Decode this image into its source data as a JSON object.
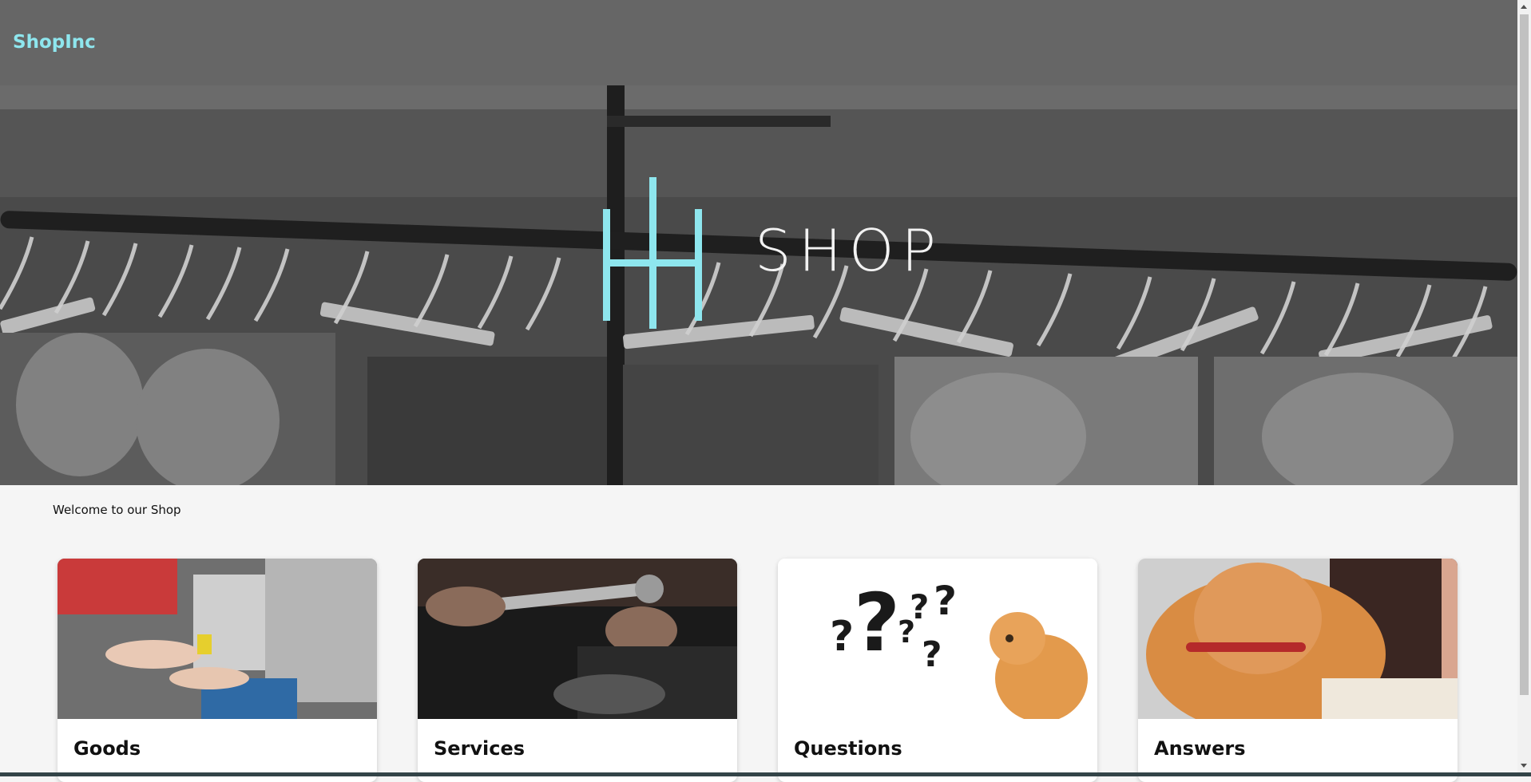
{
  "navbar": {
    "brand": "ShopInc"
  },
  "hero": {
    "logo_icon": "hh-monogram-icon",
    "logo_text": "SHOP"
  },
  "main": {
    "welcome_text": "Welcome to our Shop",
    "cards": [
      {
        "title": "Goods"
      },
      {
        "title": "Services"
      },
      {
        "title": "Questions"
      },
      {
        "title": "Answers"
      }
    ]
  },
  "colors": {
    "accent": "#8ee6ee",
    "navbar": "#666666",
    "page_bg": "#f5f5f5"
  }
}
